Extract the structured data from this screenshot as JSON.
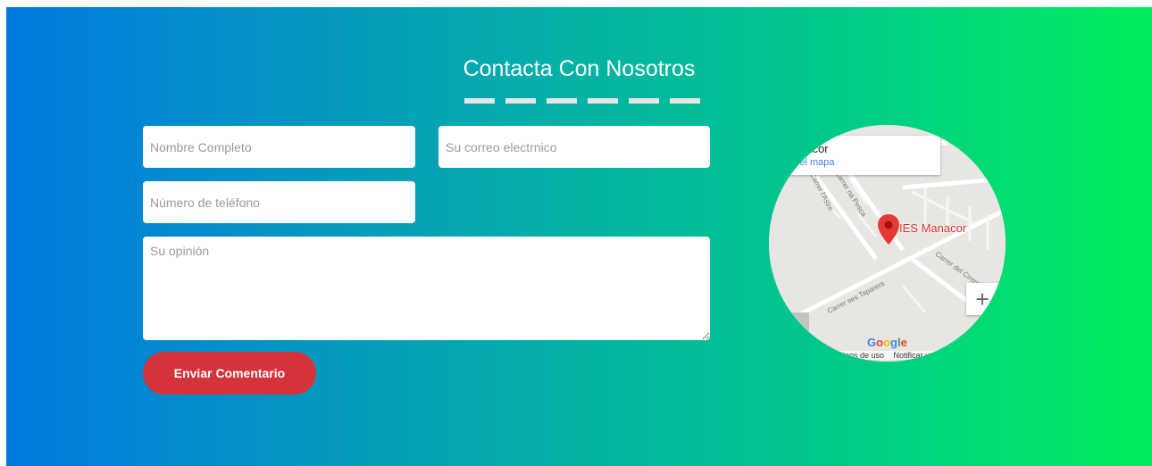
{
  "contact": {
    "title": "Contacta Con Nosotros",
    "fields": {
      "full_name_placeholder": "Nombre Completo",
      "email_placeholder": "Su correo electrnico",
      "phone_placeholder": "Número de teléfono",
      "opinion_placeholder": "Su opinión"
    },
    "submit_label": "Enviar Comentario"
  },
  "map": {
    "place_name": "Manacor",
    "enlarge_link": "Ampliar el mapa",
    "marker_label": "IES Manacor",
    "streets": [
      "Carrer l'Astre",
      "Carrer na Pesca",
      "Carrer ses Taparers",
      "Carrer del Cirerer"
    ],
    "zoom_in_label": "+",
    "google_letters": [
      "G",
      "o",
      "o",
      "g",
      "l",
      "e"
    ],
    "attribution": [
      "Términos de uso",
      "Notificar un problema de Maps"
    ]
  },
  "colors": {
    "gradient_start": "#0079e0",
    "gradient_end": "#00ef5c",
    "button": "#d4333a",
    "dashes": "#e6e6e6",
    "marker": "#e53935"
  }
}
